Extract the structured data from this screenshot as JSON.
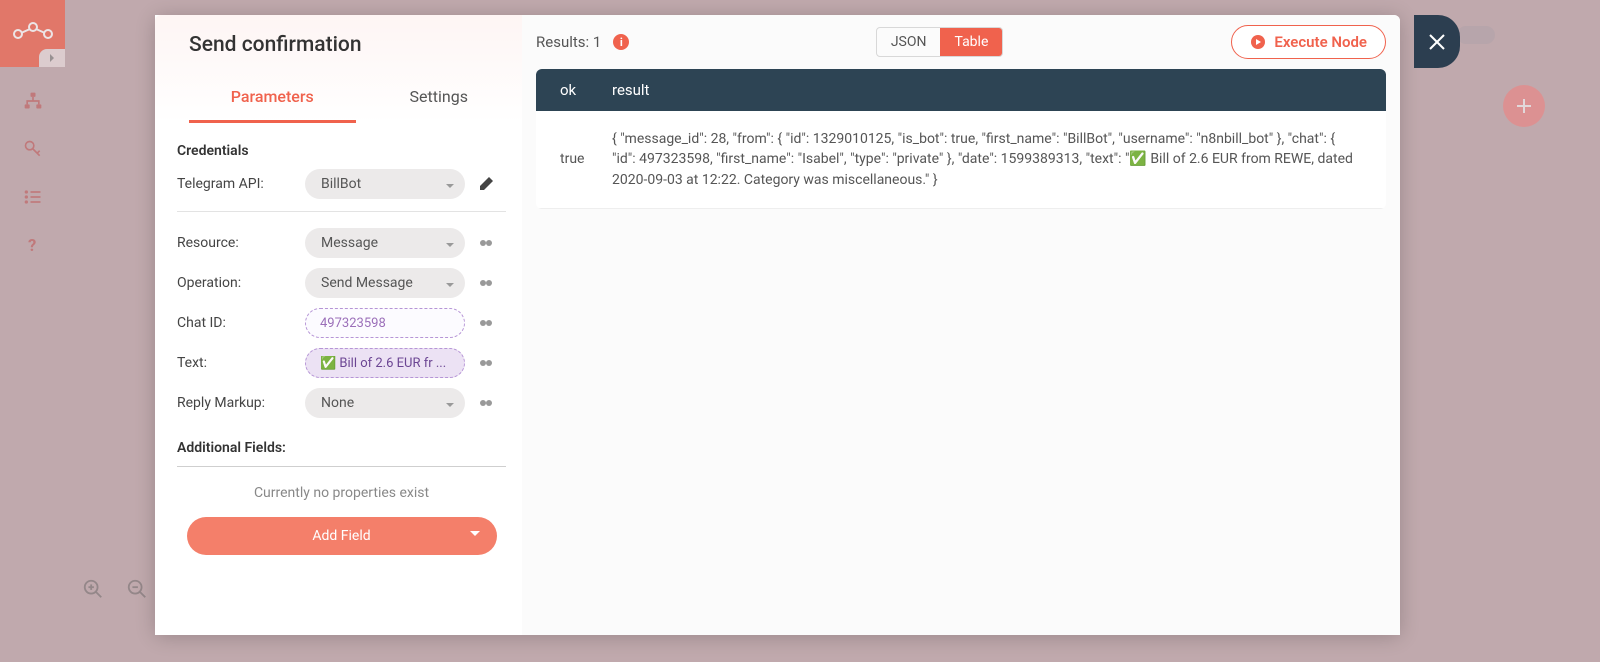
{
  "modal": {
    "title": "Send confirmation",
    "tabs": {
      "parameters": "Parameters",
      "settings": "Settings"
    },
    "credentials": {
      "section": "Credentials",
      "telegram_label": "Telegram API:",
      "telegram_value": "BillBot"
    },
    "params": {
      "resource": {
        "label": "Resource:",
        "value": "Message"
      },
      "operation": {
        "label": "Operation:",
        "value": "Send Message"
      },
      "chat_id": {
        "label": "Chat ID:",
        "value": "497323598"
      },
      "text": {
        "label": "Text:",
        "value": "✅ Bill of 2.6 EUR fr  ..."
      },
      "reply_markup": {
        "label": "Reply Markup:",
        "value": "None"
      }
    },
    "additional": {
      "section": "Additional Fields:",
      "empty": "Currently no properties exist",
      "add_button": "Add Field"
    }
  },
  "results": {
    "label": "Results: 1",
    "view_json": "JSON",
    "view_table": "Table",
    "execute": "Execute Node",
    "columns": {
      "ok": "ok",
      "result": "result"
    },
    "row": {
      "ok": "true",
      "result": "{ \"message_id\": 28, \"from\": { \"id\": 1329010125, \"is_bot\": true, \"first_name\": \"BillBot\", \"username\": \"n8nbill_bot\" }, \"chat\": { \"id\": 497323598, \"first_name\": \"Isabel\", \"type\": \"private\" }, \"date\": 1599389313, \"text\": \"✅ Bill of 2.6 EUR from REWE, dated 2020-09-03 at 12:22. Category was miscellaneous.\" }"
    }
  }
}
